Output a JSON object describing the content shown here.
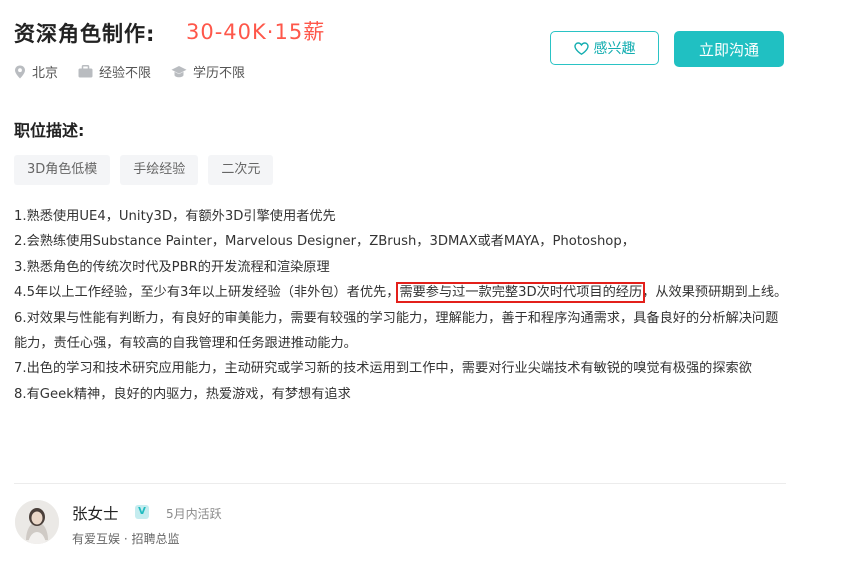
{
  "job": {
    "title": "资深角色制作:",
    "salary": "30-40K·15薪",
    "location": "北京",
    "experience": "经验不限",
    "education": "学历不限"
  },
  "actions": {
    "interest_label": "感兴趣",
    "chat_label": "立即沟通"
  },
  "description": {
    "heading": "职位描述:",
    "tags": [
      "3D角色低模",
      "手绘经验",
      "二次元"
    ],
    "lines": [
      "1.熟悉使用UE4，Unity3D，有额外3D引擎使用者优先",
      "2.会熟练使用Substance Painter，Marvelous Designer，ZBrush，3DMAX或者MAYA，Photoshop，",
      "3.熟悉角色的传统次时代及PBR的开发流程和渲染原理",
      "6.对效果与性能有判断力，有良好的审美能力，需要有较强的学习能力，理解能力，善于和程序沟通需求，具备良好的分析解决问题能力，责任心强，有较高的自我管理和任务跟进推动能力。",
      "7.出色的学习和技术研究应用能力，主动研究或学习新的技术运用到工作中，需要对行业尖端技术有敏锐的嗅觉有极强的探索欲",
      "8.有Geek精神，良好的内驱力，热爱游戏，有梦想有追求"
    ],
    "line4": {
      "before": "4.5年以上工作经验，至少有3年以上研发经验（非外包）者优先，",
      "highlighted": "需要参与过一款完整3D次时代项目的经历",
      "after": "，从效果预研期到上线。"
    }
  },
  "recruiter": {
    "name": "张女士",
    "verified_mark": "V",
    "status": "5月内活跃",
    "company": "有爱互娱 · 招聘总监"
  },
  "colors": {
    "accent": "#20c0c2",
    "salary": "#fe574a",
    "highlight_box": "#e3201b"
  }
}
